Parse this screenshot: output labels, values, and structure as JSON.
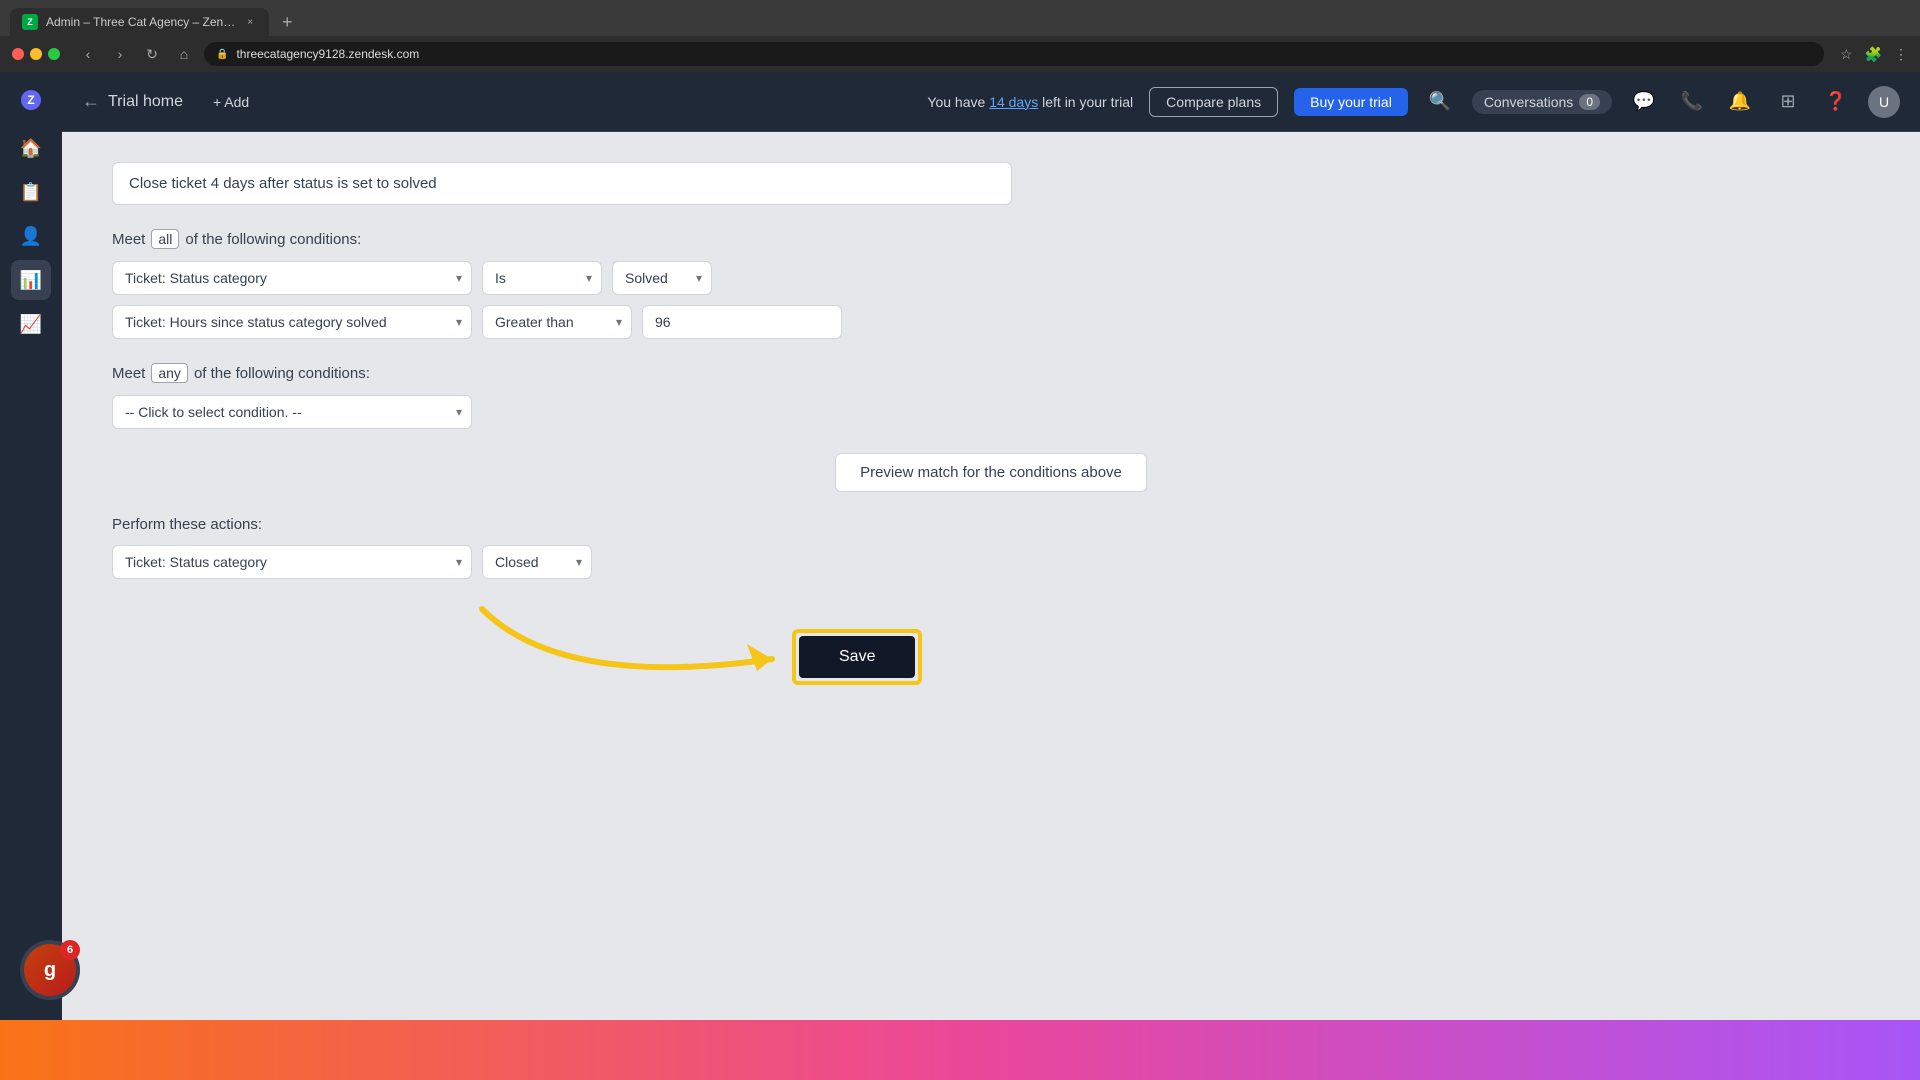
{
  "browser": {
    "tab_title": "Admin – Three Cat Agency – Zen…",
    "url": "threecatagency9128.zendesk.com",
    "new_tab_icon": "+"
  },
  "topbar": {
    "back_arrow": "←",
    "trial_home": "Trial home",
    "add_label": "+ Add",
    "trial_notice": "You have ",
    "trial_days": "14 days",
    "trial_notice_end": " left in your trial",
    "compare_plans": "Compare plans",
    "buy_trial": "Buy your trial",
    "conversations_label": "Conversations",
    "conversations_count": "0"
  },
  "form": {
    "title": "Close ticket 4 days after status is set to solved",
    "all_conditions_label": "Meet",
    "all_keyword": "all",
    "all_conditions_suffix": "of the following conditions:",
    "any_conditions_label": "Meet",
    "any_keyword": "any",
    "any_conditions_suffix": "of the following conditions:",
    "condition_row1_field": "Ticket: Status category",
    "condition_row1_op": "Is",
    "condition_row1_value": "Solved",
    "condition_row2_field": "Ticket: Hours since status category solved",
    "condition_row2_op": "Greater than",
    "condition_row2_value": "96",
    "any_condition_placeholder": "-- Click to select condition. --",
    "preview_btn": "Preview match for the conditions above",
    "actions_label": "Perform these actions:",
    "action_row1_field": "Ticket: Status category",
    "action_row1_value": "Closed",
    "save_label": "Save"
  }
}
